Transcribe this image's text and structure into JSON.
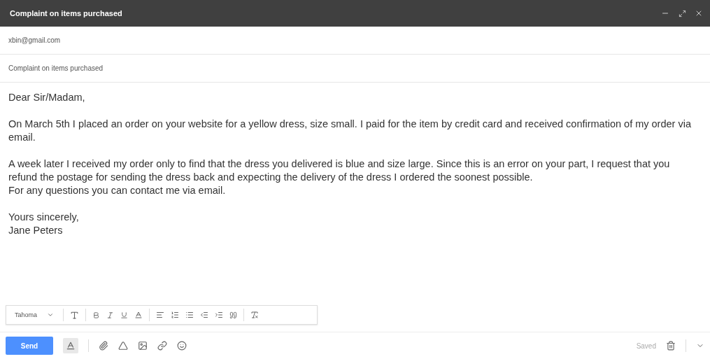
{
  "window": {
    "title": "Complaint on items purchased"
  },
  "to": {
    "value": "xbin@gmail.com"
  },
  "subject": {
    "value": "Complaint on items purchased"
  },
  "body": {
    "paragraphs": [
      [
        "Dear Sir/Madam,"
      ],
      [
        "On March 5th I placed an order on your website for a yellow dress, size small. I paid for the item by credit card and received confirmation of my order via email."
      ],
      [
        "A week later I received my order only to find that the dress you delivered is blue and size large. Since this is an error on your part, I request that you refund the postage for sending the dress back and expecting the delivery of the dress I ordered the soonest possible.",
        "For any questions you can contact me via email."
      ],
      [
        "Yours sincerely,",
        "Jane Peters"
      ]
    ]
  },
  "format_toolbar": {
    "font": "Tahoma"
  },
  "bottom_bar": {
    "send_label": "Send",
    "formatting_selected": true,
    "status": "Saved"
  }
}
